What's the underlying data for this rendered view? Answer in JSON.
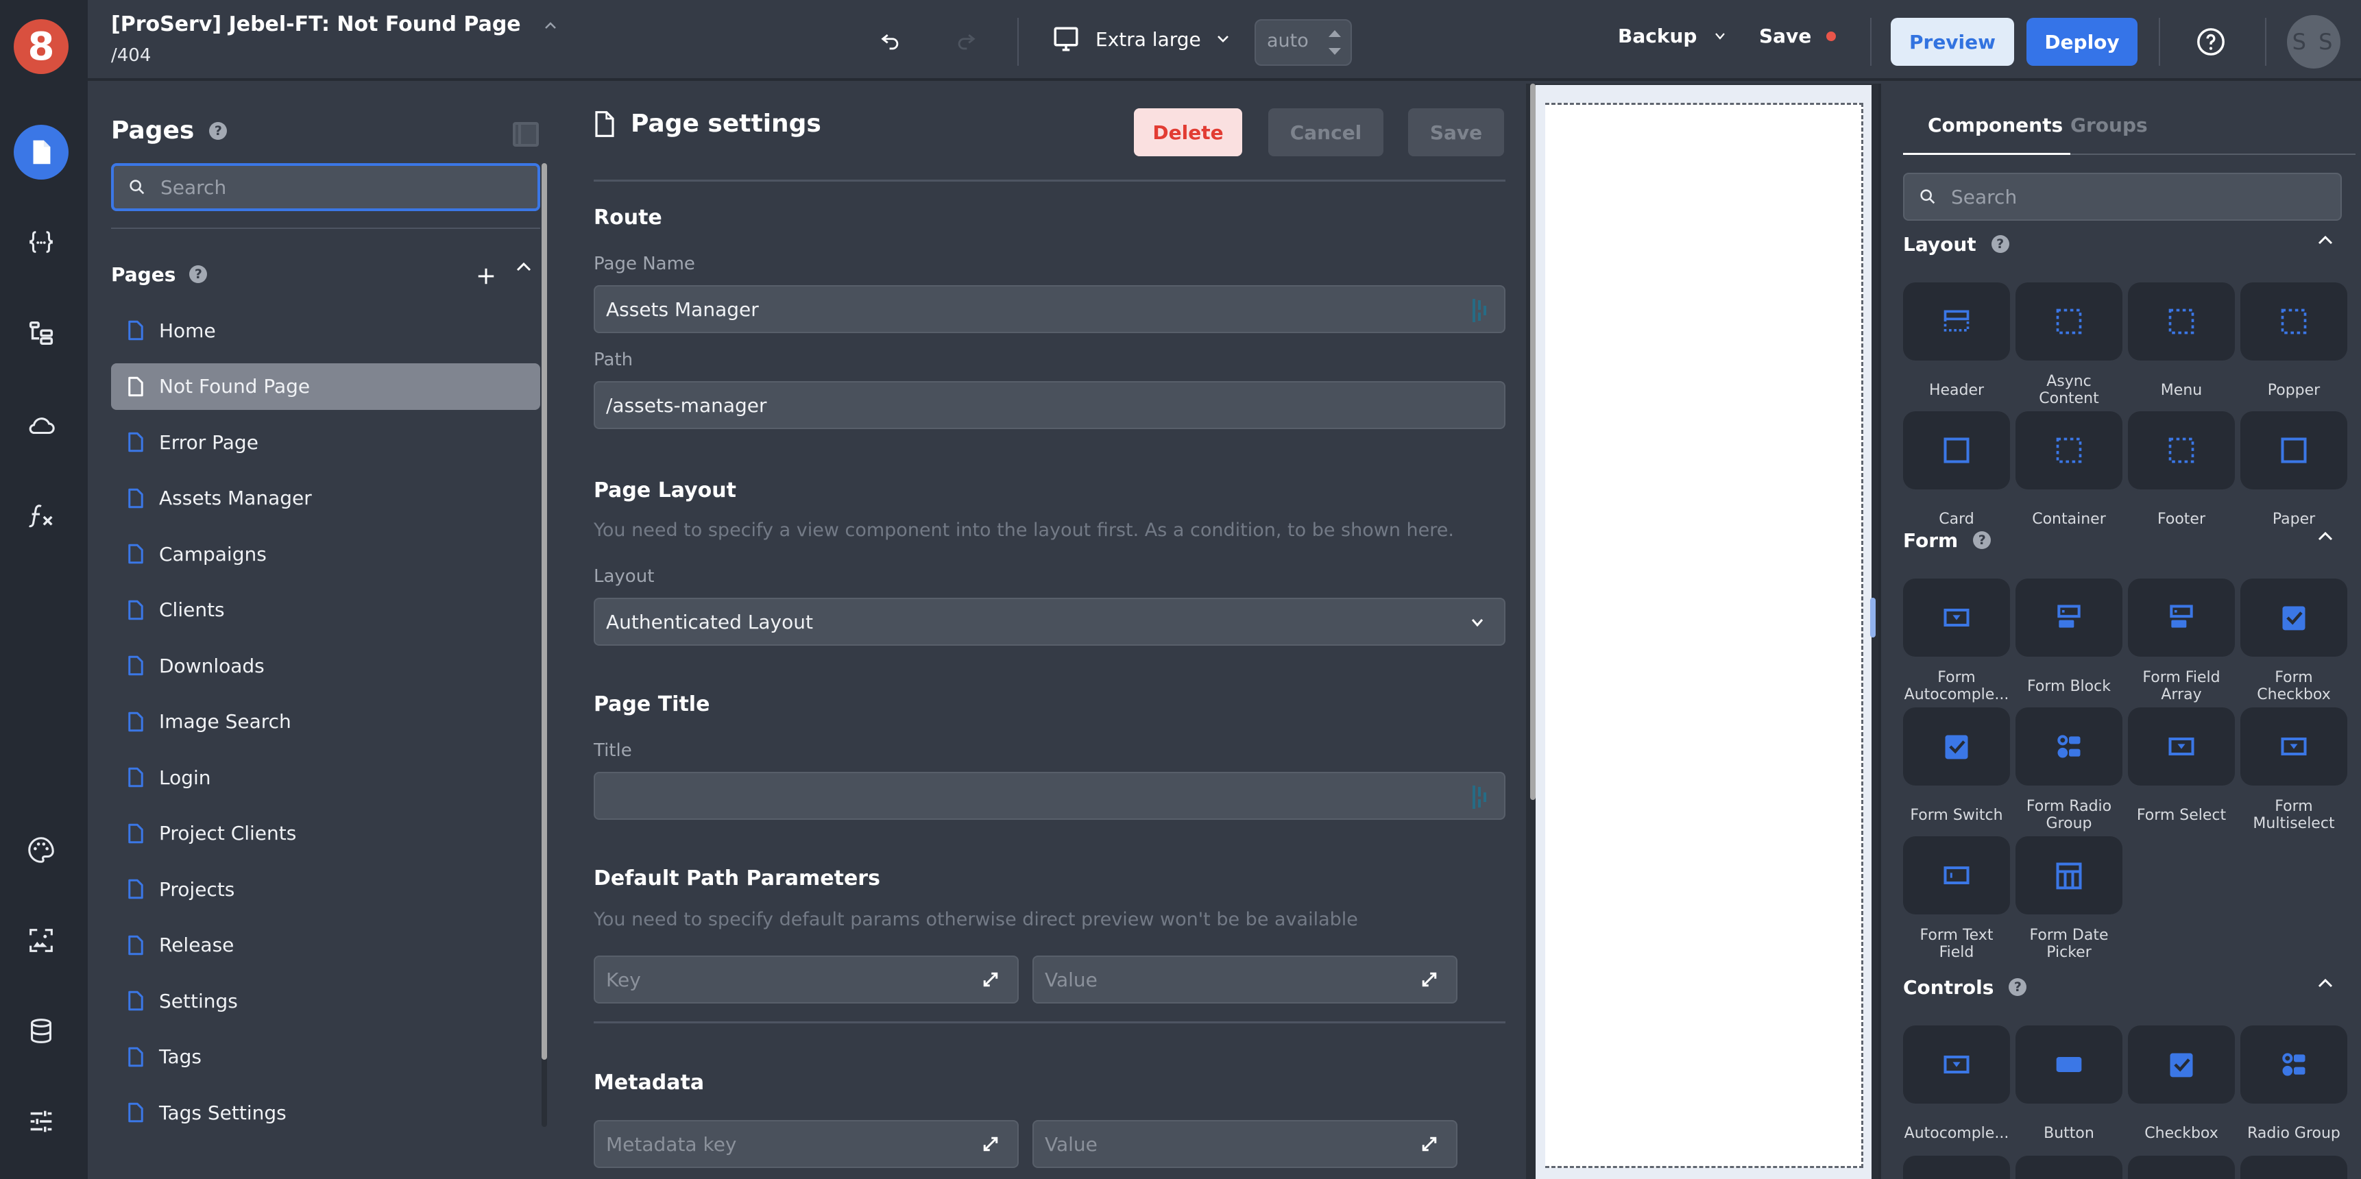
{
  "app": {
    "title": "[ProServ] Jebel-FT: Not Found Page",
    "route": "/404",
    "logo": "8"
  },
  "rail": {
    "items": [
      {
        "icon": "page-icon",
        "active": true
      },
      {
        "icon": "variables-icon",
        "active": false
      },
      {
        "icon": "components-tree-icon",
        "active": false
      },
      {
        "icon": "cloud-icon",
        "active": false
      },
      {
        "icon": "function-icon",
        "active": false
      },
      {
        "icon": "palette-icon",
        "active": false
      },
      {
        "icon": "media-icon",
        "active": false
      },
      {
        "icon": "database-icon",
        "active": false
      },
      {
        "icon": "settings-sliders-icon",
        "active": false
      }
    ]
  },
  "toolbar": {
    "device_label": "Extra large",
    "width_value": "auto",
    "backup_label": "Backup",
    "save_label": "Save",
    "preview_label": "Preview",
    "deploy_label": "Deploy",
    "avatar_initials": "S S",
    "unsaved_color": "#e9554a",
    "accent_color": "#3574e8"
  },
  "pages_panel": {
    "title": "Pages",
    "search_placeholder": "Search",
    "section_title": "Pages",
    "items": [
      {
        "label": "Home",
        "active": false
      },
      {
        "label": "Not Found Page",
        "active": true
      },
      {
        "label": "Error Page",
        "active": false
      },
      {
        "label": "Assets Manager",
        "active": false
      },
      {
        "label": "Campaigns",
        "active": false
      },
      {
        "label": "Clients",
        "active": false
      },
      {
        "label": "Downloads",
        "active": false
      },
      {
        "label": "Image Search",
        "active": false
      },
      {
        "label": "Login",
        "active": false
      },
      {
        "label": "Project Clients",
        "active": false
      },
      {
        "label": "Projects",
        "active": false
      },
      {
        "label": "Release",
        "active": false
      },
      {
        "label": "Settings",
        "active": false
      },
      {
        "label": "Tags",
        "active": false
      },
      {
        "label": "Tags Settings",
        "active": false
      }
    ]
  },
  "settings": {
    "title": "Page settings",
    "delete_label": "Delete",
    "cancel_label": "Cancel",
    "save_label": "Save",
    "route": {
      "title": "Route",
      "page_name_label": "Page Name",
      "page_name_value": "Assets Manager",
      "path_label": "Path",
      "path_value": "/assets-manager"
    },
    "layout": {
      "title": "Page Layout",
      "hint": "You need to specify a view component into the layout first. As a condition, to be shown here.",
      "layout_label": "Layout",
      "layout_value": "Authenticated Layout"
    },
    "page_title": {
      "title": "Page Title",
      "title_label": "Title",
      "title_value": ""
    },
    "params": {
      "title": "Default Path Parameters",
      "hint": "You need to specify default params otherwise direct preview won't be be available",
      "key_placeholder": "Key",
      "value_placeholder": "Value"
    },
    "metadata": {
      "title": "Metadata",
      "key_placeholder": "Metadata key",
      "value_placeholder": "Value"
    }
  },
  "components_panel": {
    "tabs": [
      {
        "label": "Components",
        "active": true
      },
      {
        "label": "Groups",
        "active": false
      }
    ],
    "search_placeholder": "Search",
    "categories": [
      {
        "name": "Layout",
        "items": [
          {
            "label": "Header",
            "icon": "header-layout-icon"
          },
          {
            "label": "Async Content",
            "icon": "dashed-box-icon"
          },
          {
            "label": "Menu",
            "icon": "dashed-box-icon"
          },
          {
            "label": "Popper",
            "icon": "dashed-box-icon"
          },
          {
            "label": "Card",
            "icon": "solid-box-icon"
          },
          {
            "label": "Container",
            "icon": "dashed-box-icon"
          },
          {
            "label": "Footer",
            "icon": "dashed-box-icon"
          },
          {
            "label": "Paper",
            "icon": "solid-box-icon"
          }
        ]
      },
      {
        "name": "Form",
        "items": [
          {
            "label": "Form Autocomple...",
            "icon": "select-icon"
          },
          {
            "label": "Form Block",
            "icon": "form-block-icon"
          },
          {
            "label": "Form Field Array",
            "icon": "form-block-icon"
          },
          {
            "label": "Form Checkbox",
            "icon": "checkbox-icon"
          },
          {
            "label": "Form Switch",
            "icon": "checkbox-icon"
          },
          {
            "label": "Form Radio Group",
            "icon": "radio-group-icon"
          },
          {
            "label": "Form Select",
            "icon": "select-icon"
          },
          {
            "label": "Form Multiselect",
            "icon": "select-icon"
          },
          {
            "label": "Form Text Field",
            "icon": "text-field-icon"
          },
          {
            "label": "Form Date Picker",
            "icon": "calendar-icon"
          }
        ]
      },
      {
        "name": "Controls",
        "items": [
          {
            "label": "Autocomple...",
            "icon": "select-icon"
          },
          {
            "label": "Button",
            "icon": "button-icon"
          },
          {
            "label": "Checkbox",
            "icon": "checkbox-icon"
          },
          {
            "label": "Radio Group",
            "icon": "radio-group-icon"
          }
        ]
      }
    ]
  }
}
